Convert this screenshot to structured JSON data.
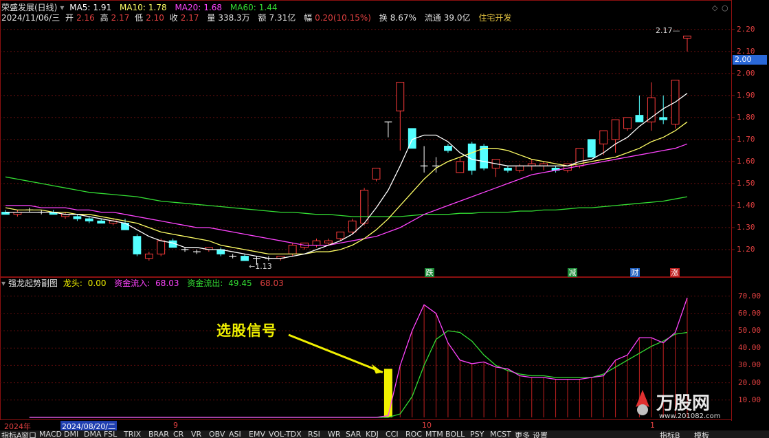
{
  "header": {
    "stock_name": "荣盛发展(日线)",
    "ma5_label": "MA5:",
    "ma5_value": "1.91",
    "ma10_label": "MA10:",
    "ma10_value": "1.78",
    "ma20_label": "MA20:",
    "ma20_value": "1.68",
    "ma60_label": "MA60:",
    "ma60_value": "1.44",
    "date": "2024/11/06/三",
    "open_label": "开",
    "open": "2.16",
    "high_label": "高",
    "high": "2.17",
    "low_label": "低",
    "low": "2.10",
    "close_label": "收",
    "close": "2.17",
    "volume_label": "量",
    "volume": "338.3万",
    "amount_label": "额",
    "amount": "7.31亿",
    "change_label": "幅",
    "change": "0.20(10.15%)",
    "turnover_label": "换",
    "turnover": "8.67%",
    "float_label": "流通",
    "float_value": "39.0亿",
    "sector": "住宅开发"
  },
  "sub_header": {
    "indicator_name": "强龙起势副图",
    "dragon_label": "龙头:",
    "dragon_value": "0.00",
    "inflow_label": "资金流入:",
    "inflow_value": "68.03",
    "outflow_label": "资金流出:",
    "outflow_value": "49.45",
    "extra_value": "68.03"
  },
  "annotations": {
    "high_marker": "2.17",
    "low_marker": "1.13",
    "signal_text": "选股信号",
    "current_price_tag": "2.00"
  },
  "events": [
    {
      "label": "跌",
      "color": "#1f8c3a"
    },
    {
      "label": "减",
      "color": "#1f8c3a"
    },
    {
      "label": "财",
      "color": "#2060c0"
    },
    {
      "label": "涨",
      "color": "#c02020"
    }
  ],
  "date_bar": {
    "year": "2024年",
    "selected_date": "2024/08/20/二",
    "month_9": "9",
    "month_10": "10",
    "month_11": "1"
  },
  "tabs": [
    "指标A",
    "窗口",
    "MACD",
    "DMI",
    "DMA",
    "FSL",
    "TRIX",
    "BRAR",
    "CR",
    "VR",
    "OBV",
    "ASI",
    "EMV",
    "VOL-TDX",
    "RSI",
    "WR",
    "SAR",
    "KDJ",
    "CCI",
    "ROC",
    "MTM",
    "BOLL",
    "PSY",
    "MCST",
    "更多",
    "设置"
  ],
  "tabs_right": [
    "指标B",
    "模板"
  ],
  "watermark": "万股网",
  "watermark_url": "www.201082.com",
  "colors": {
    "up": "#ff3c3c",
    "down": "#54ffff",
    "ma5": "#ffffff",
    "ma10": "#ffff66",
    "ma20": "#ff44ff",
    "ma60": "#33dd33",
    "inflow": "#ff44ff",
    "outflow": "#33dd33",
    "signal": "#f0f000"
  },
  "chart_data": [
    {
      "type": "candlestick",
      "title": "荣盛发展(日线)",
      "ylim": [
        1.1,
        2.24
      ],
      "y_ticks": [
        "2.20",
        "2.10",
        "2.00",
        "1.90",
        "1.80",
        "1.70",
        "1.60",
        "1.50",
        "1.40",
        "1.30",
        "1.20"
      ],
      "candles": [
        [
          1.37,
          1.38,
          1.36,
          1.36
        ],
        [
          1.36,
          1.38,
          1.35,
          1.37
        ],
        [
          1.38,
          1.39,
          1.37,
          1.38
        ],
        [
          1.37,
          1.38,
          1.36,
          1.37
        ],
        [
          1.37,
          1.38,
          1.36,
          1.36
        ],
        [
          1.35,
          1.37,
          1.34,
          1.36
        ],
        [
          1.35,
          1.36,
          1.33,
          1.34
        ],
        [
          1.34,
          1.35,
          1.32,
          1.33
        ],
        [
          1.33,
          1.34,
          1.32,
          1.32
        ],
        [
          1.32,
          1.34,
          1.31,
          1.33
        ],
        [
          1.32,
          1.34,
          1.31,
          1.29
        ],
        [
          1.26,
          1.27,
          1.17,
          1.18
        ],
        [
          1.16,
          1.19,
          1.15,
          1.18
        ],
        [
          1.18,
          1.25,
          1.17,
          1.24
        ],
        [
          1.24,
          1.25,
          1.21,
          1.21
        ],
        [
          1.2,
          1.21,
          1.19,
          1.2
        ],
        [
          1.19,
          1.2,
          1.18,
          1.19
        ],
        [
          1.2,
          1.21,
          1.19,
          1.21
        ],
        [
          1.2,
          1.21,
          1.17,
          1.18
        ],
        [
          1.17,
          1.18,
          1.16,
          1.17
        ],
        [
          1.17,
          1.18,
          1.16,
          1.15
        ],
        [
          1.16,
          1.17,
          1.13,
          1.16
        ],
        [
          1.16,
          1.17,
          1.15,
          1.16
        ],
        [
          1.16,
          1.17,
          1.15,
          1.17
        ],
        [
          1.18,
          1.23,
          1.17,
          1.22
        ],
        [
          1.21,
          1.23,
          1.2,
          1.23
        ],
        [
          1.22,
          1.25,
          1.21,
          1.24
        ],
        [
          1.23,
          1.25,
          1.22,
          1.24
        ],
        [
          1.25,
          1.28,
          1.24,
          1.28
        ],
        [
          1.28,
          1.34,
          1.27,
          1.33
        ],
        [
          1.32,
          1.48,
          1.31,
          1.47
        ],
        [
          1.52,
          1.57,
          1.51,
          1.57
        ],
        [
          1.78,
          1.78,
          1.71,
          1.78
        ],
        [
          1.83,
          1.96,
          1.65,
          1.96
        ],
        [
          1.75,
          1.75,
          1.66,
          1.66
        ],
        [
          1.58,
          1.67,
          1.55,
          1.58
        ],
        [
          1.58,
          1.62,
          1.55,
          1.58
        ],
        [
          1.67,
          1.68,
          1.64,
          1.65
        ],
        [
          1.55,
          1.62,
          1.55,
          1.6
        ],
        [
          1.68,
          1.69,
          1.54,
          1.56
        ],
        [
          1.67,
          1.68,
          1.56,
          1.57
        ],
        [
          1.57,
          1.61,
          1.53,
          1.61
        ],
        [
          1.57,
          1.58,
          1.55,
          1.56
        ],
        [
          1.56,
          1.59,
          1.55,
          1.58
        ],
        [
          1.58,
          1.61,
          1.56,
          1.59
        ],
        [
          1.58,
          1.6,
          1.56,
          1.59
        ],
        [
          1.57,
          1.58,
          1.55,
          1.56
        ],
        [
          1.56,
          1.59,
          1.55,
          1.59
        ],
        [
          1.58,
          1.66,
          1.57,
          1.66
        ],
        [
          1.7,
          1.7,
          1.62,
          1.62
        ],
        [
          1.68,
          1.74,
          1.63,
          1.74
        ],
        [
          1.7,
          1.79,
          1.64,
          1.79
        ],
        [
          1.75,
          1.8,
          1.74,
          1.8
        ],
        [
          1.81,
          1.9,
          1.78,
          1.78
        ],
        [
          1.78,
          1.96,
          1.74,
          1.89
        ],
        [
          1.8,
          1.9,
          1.77,
          1.79
        ],
        [
          1.77,
          1.97,
          1.75,
          1.97
        ],
        [
          2.16,
          2.17,
          2.1,
          2.17
        ]
      ],
      "ma5": [
        1.37,
        1.37,
        1.37,
        1.37,
        1.37,
        1.36,
        1.36,
        1.35,
        1.34,
        1.33,
        1.32,
        1.29,
        1.26,
        1.24,
        1.23,
        1.21,
        1.21,
        1.2,
        1.2,
        1.19,
        1.18,
        1.17,
        1.16,
        1.16,
        1.17,
        1.18,
        1.2,
        1.22,
        1.24,
        1.27,
        1.32,
        1.39,
        1.47,
        1.58,
        1.7,
        1.72,
        1.72,
        1.69,
        1.64,
        1.61,
        1.6,
        1.59,
        1.58,
        1.58,
        1.58,
        1.58,
        1.58,
        1.58,
        1.6,
        1.61,
        1.64,
        1.68,
        1.71,
        1.76,
        1.8,
        1.84,
        1.87,
        1.91
      ],
      "ma10": [
        1.39,
        1.38,
        1.38,
        1.38,
        1.37,
        1.37,
        1.36,
        1.36,
        1.35,
        1.34,
        1.33,
        1.32,
        1.3,
        1.28,
        1.27,
        1.26,
        1.25,
        1.24,
        1.22,
        1.21,
        1.2,
        1.19,
        1.18,
        1.18,
        1.18,
        1.18,
        1.19,
        1.19,
        1.2,
        1.22,
        1.25,
        1.29,
        1.34,
        1.4,
        1.46,
        1.52,
        1.57,
        1.6,
        1.62,
        1.64,
        1.66,
        1.66,
        1.65,
        1.63,
        1.61,
        1.6,
        1.59,
        1.58,
        1.59,
        1.6,
        1.61,
        1.62,
        1.64,
        1.66,
        1.69,
        1.71,
        1.74,
        1.78
      ],
      "ma20": [
        1.4,
        1.4,
        1.4,
        1.39,
        1.39,
        1.39,
        1.38,
        1.38,
        1.37,
        1.37,
        1.36,
        1.35,
        1.34,
        1.33,
        1.32,
        1.31,
        1.3,
        1.3,
        1.29,
        1.28,
        1.27,
        1.26,
        1.25,
        1.24,
        1.23,
        1.22,
        1.22,
        1.22,
        1.23,
        1.24,
        1.25,
        1.26,
        1.28,
        1.3,
        1.33,
        1.36,
        1.38,
        1.4,
        1.42,
        1.44,
        1.46,
        1.48,
        1.5,
        1.52,
        1.54,
        1.55,
        1.56,
        1.57,
        1.58,
        1.59,
        1.6,
        1.61,
        1.62,
        1.63,
        1.64,
        1.65,
        1.66,
        1.68
      ],
      "ma60": [
        1.53,
        1.52,
        1.51,
        1.5,
        1.49,
        1.48,
        1.47,
        1.46,
        1.455,
        1.45,
        1.445,
        1.44,
        1.43,
        1.42,
        1.415,
        1.41,
        1.405,
        1.4,
        1.395,
        1.39,
        1.385,
        1.38,
        1.375,
        1.37,
        1.37,
        1.365,
        1.36,
        1.36,
        1.355,
        1.35,
        1.35,
        1.35,
        1.35,
        1.35,
        1.355,
        1.36,
        1.36,
        1.36,
        1.365,
        1.365,
        1.37,
        1.37,
        1.37,
        1.375,
        1.375,
        1.38,
        1.38,
        1.385,
        1.39,
        1.39,
        1.395,
        1.4,
        1.405,
        1.41,
        1.415,
        1.42,
        1.43,
        1.44
      ]
    },
    {
      "type": "line",
      "title": "强龙起势副图",
      "ylim": [
        0,
        75
      ],
      "y_ticks": [
        "70.00",
        "60.00",
        "50.00",
        "40.00",
        "30.00",
        "20.00",
        "10.00"
      ],
      "signal_index": 30,
      "inflow": [
        0,
        0,
        0,
        0,
        0,
        0,
        0,
        0,
        0,
        0,
        0,
        0,
        0,
        0,
        0,
        0,
        0,
        0,
        0,
        0,
        0,
        0,
        0,
        0,
        0,
        0,
        0,
        0,
        0,
        0,
        1,
        30,
        50,
        65,
        60,
        43,
        33,
        31,
        32,
        29,
        28,
        24,
        23,
        23,
        22,
        22,
        22,
        23,
        24,
        33,
        36,
        46,
        46,
        43,
        49,
        69
      ],
      "outflow": [
        0,
        0,
        0,
        0,
        0,
        0,
        0,
        0,
        0,
        0,
        0,
        0,
        0,
        0,
        0,
        0,
        0,
        0,
        0,
        0,
        0,
        0,
        0,
        0,
        0,
        0,
        0,
        0,
        0,
        0,
        0,
        2,
        12,
        30,
        45,
        50,
        49,
        44,
        36,
        30,
        27,
        25,
        24,
        24,
        23,
        23,
        23,
        23,
        25,
        29,
        33,
        37,
        41,
        44,
        48,
        49
      ]
    }
  ]
}
